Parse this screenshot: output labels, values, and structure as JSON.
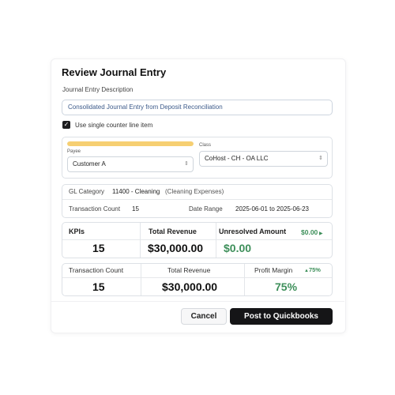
{
  "dialog": {
    "title": "Review Journal Entry",
    "description_label": "Journal Entry Description",
    "description_value": "Consolidated Journal Entry from Deposit Reconciliation",
    "single_counter_label": "Use single counter line item",
    "single_counter_checked": true
  },
  "payee": {
    "progress": 1.0,
    "label": "Payee",
    "value": "Customer A"
  },
  "class_field": {
    "label": "Class",
    "value": "CoHost - CH - OA LLC"
  },
  "gl": {
    "category_label": "GL Category",
    "category_code": "11400 - Cleaning",
    "category_desc": "(Cleaning Expenses)",
    "txn_count_label": "Transaction Count",
    "txn_count_value": "15",
    "date_range_label": "Date Range",
    "date_range_value": "2025-06-01 to 2025-06-23"
  },
  "kpis": {
    "kpis_label": "KPIs",
    "kpis_value": "15",
    "total_revenue_label": "Total Revenue",
    "total_revenue_value": "$30,000.00",
    "unresolved_label": "Unresolved Amount",
    "unresolved_badge": "$0.00",
    "unresolved_value": "$0.00"
  },
  "kpis2": {
    "txn_count_label": "Transaction Count",
    "txn_count_value": "15",
    "total_revenue_label": "Total Revenue",
    "total_revenue_value": "$30,000.00",
    "profit_margin_label": "Profit Margin",
    "profit_margin_delta": "75%",
    "profit_margin_value": "75%"
  },
  "actions": {
    "cancel_label": "Cancel",
    "post_label": "Post to Quickbooks"
  },
  "colors": {
    "accent_green": "#3d8f5a",
    "progress_yellow": "#f6cf72",
    "primary_button": "#151517"
  }
}
